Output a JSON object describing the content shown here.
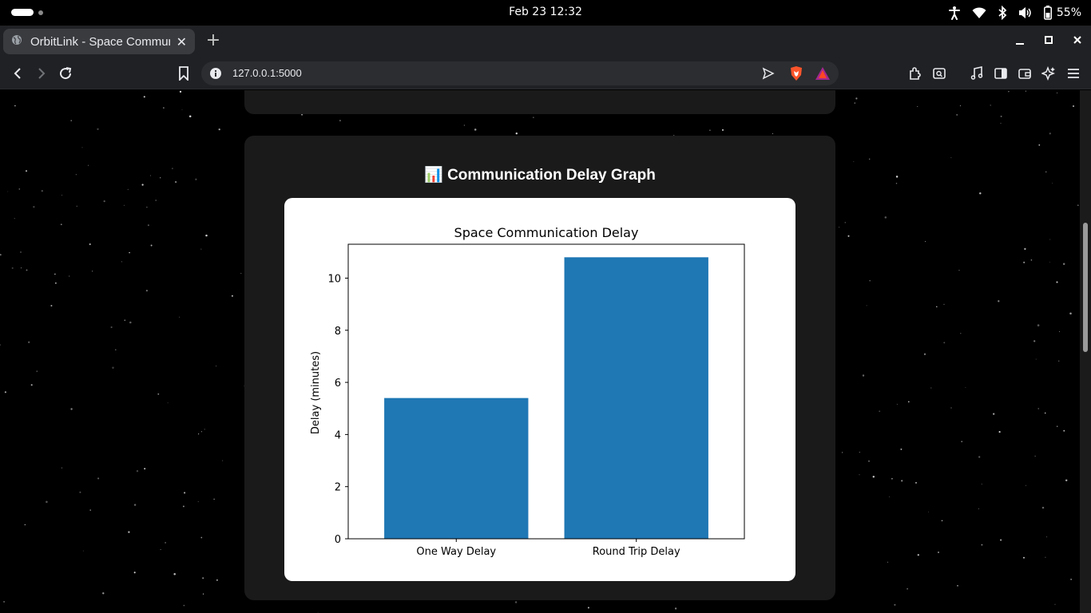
{
  "system_bar": {
    "clock": "Feb 23  12:32",
    "battery": "55%"
  },
  "browser": {
    "tab_title": "OrbitLink - Space Communication",
    "tab_close": "✕",
    "new_tab": "+",
    "url": "127.0.0.1:5000"
  },
  "page": {
    "graph_heading_icon": "📊",
    "graph_heading": "Communication Delay Graph"
  },
  "chart_data": {
    "type": "bar",
    "title": "Space Communication Delay",
    "xlabel": "",
    "ylabel": "Delay (minutes)",
    "categories": [
      "One Way Delay",
      "Round Trip Delay"
    ],
    "values": [
      5.4,
      10.8
    ],
    "ylim": [
      0,
      11.3
    ],
    "yticks": [
      0,
      2,
      4,
      6,
      8,
      10
    ],
    "bar_color": "#1f77b4",
    "grid": false,
    "legend": "none"
  }
}
